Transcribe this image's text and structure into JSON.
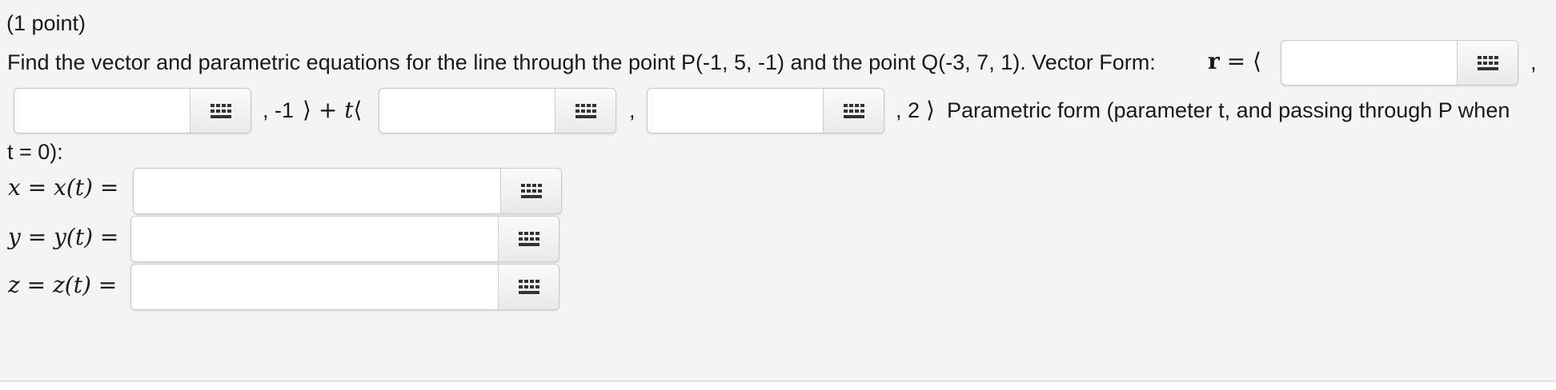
{
  "question": {
    "points": "(1 point)",
    "prompt": "Find the vector and parametric equations for the line through the point P(-1, 5, -1) and the point Q(-3, 7, 1). Vector Form:",
    "vector_symbol": "r",
    "equals": "=",
    "open_angle": "⟨",
    "close_angle": "⟩",
    "comma": ",",
    "fixed_z_point": "-1",
    "plus_t": "+ ",
    "t_symbol": "t",
    "fixed_z_direction": "2",
    "parametric_label_line1": "Parametric form (parameter t, and passing through P when",
    "parametric_label_line2": "t = 0):"
  },
  "parametric": {
    "x_lhs": "x = x(t) =",
    "y_lhs": "y = y(t) =",
    "z_lhs": "z = z(t) =",
    "x_value": "",
    "y_value": "",
    "z_value": ""
  },
  "vector": {
    "point_x_value": "",
    "point_y_value": "",
    "direction_x_value": "",
    "direction_y_value": ""
  },
  "icons": {
    "math_keyboard": "keypad-grid-icon"
  }
}
